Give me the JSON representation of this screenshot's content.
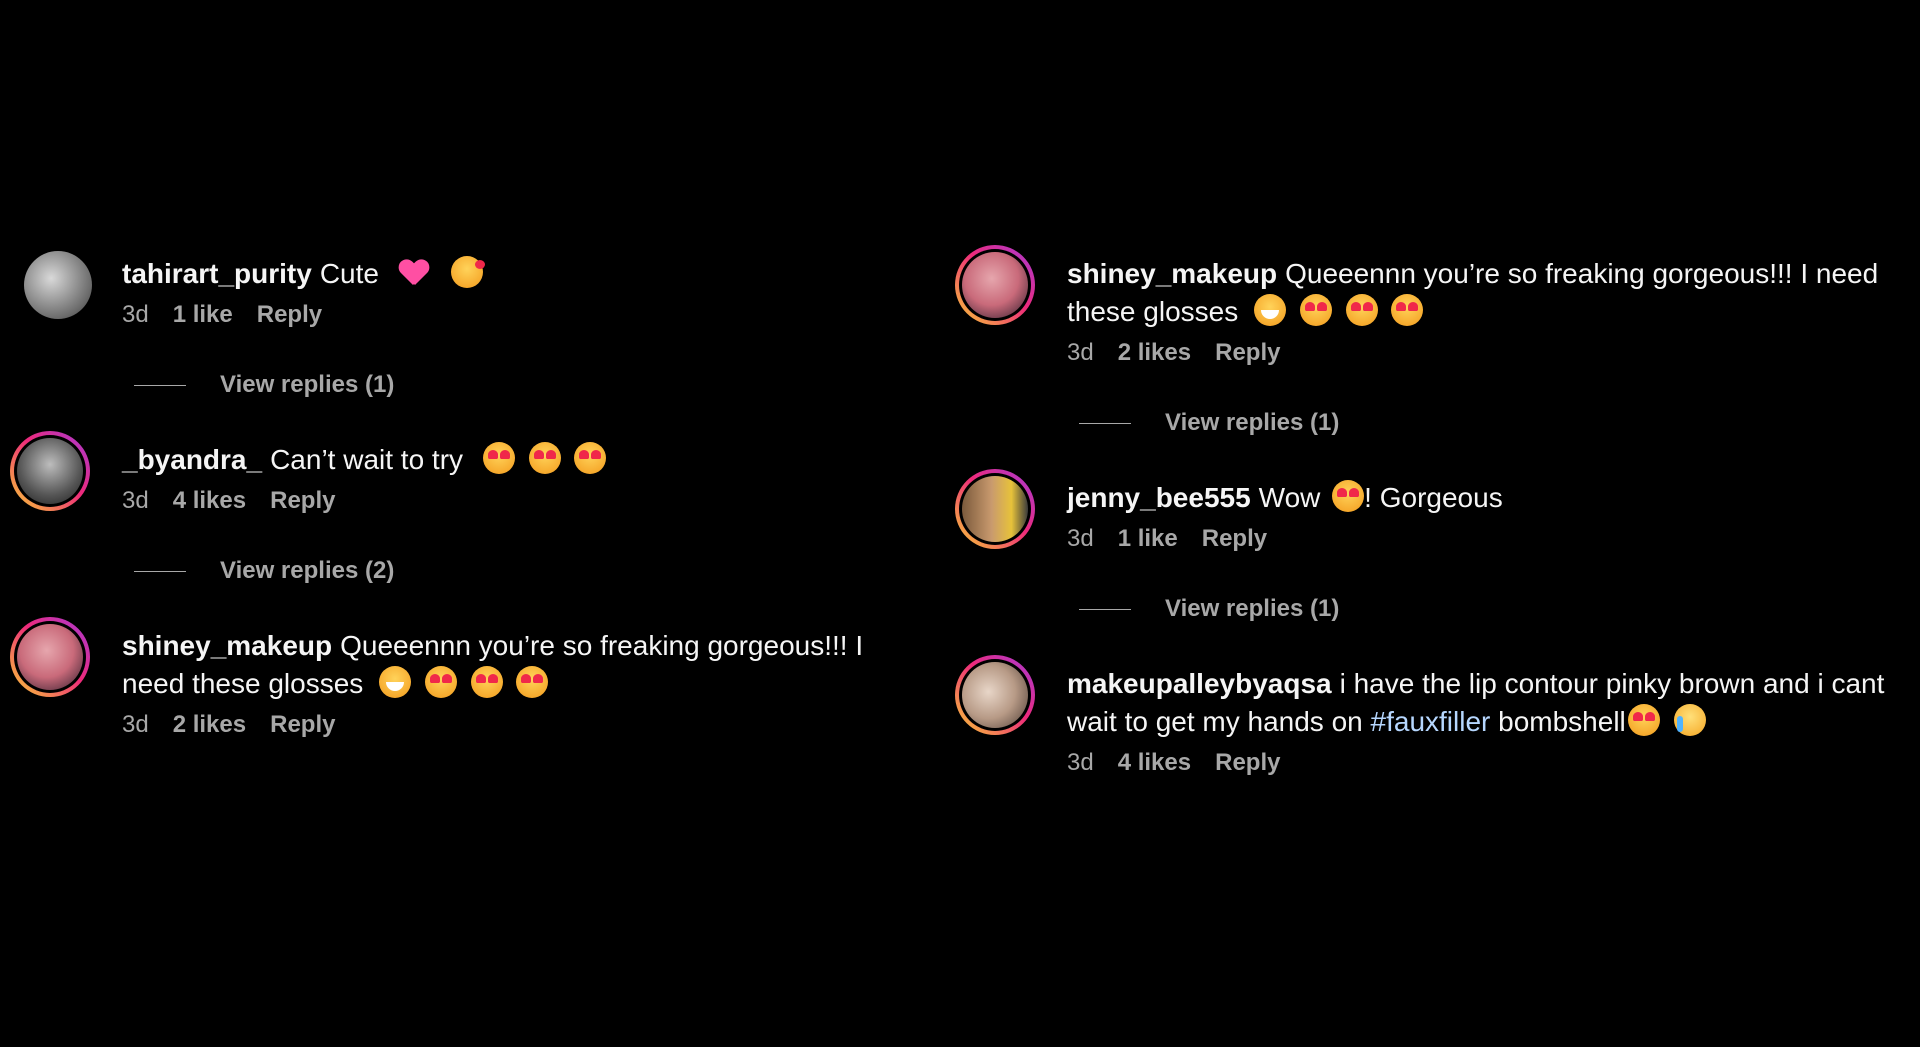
{
  "left_column": [
    {
      "username": "tahirart_purity",
      "text": "Cute",
      "emojis_after": [
        "pink-heart",
        "smiling-face-with-hearts"
      ],
      "time": "3d",
      "likes": "1 like",
      "reply": "Reply",
      "view_replies": "View replies (1)",
      "avatar_colors": [
        "#6b6b6b",
        "#d9d9d9"
      ],
      "ring": false
    },
    {
      "username": "_byandra_",
      "text": "Can’t wait to try",
      "emojis_after": [
        "heart-eyes",
        "heart-eyes",
        "heart-eyes"
      ],
      "time": "3d",
      "likes": "4 likes",
      "reply": "Reply",
      "view_replies": "View replies (2)",
      "avatar_colors": [
        "#3a3a3a",
        "#bdbdbd"
      ],
      "ring": true
    },
    {
      "username": "shiney_makeup",
      "text": "Queeennn you’re so freaking gorgeous!!! I need these glosses",
      "emojis_after": [
        "grin",
        "heart-eyes",
        "heart-eyes",
        "heart-eyes"
      ],
      "time": "3d",
      "likes": "2 likes",
      "reply": "Reply",
      "avatar_colors": [
        "#c96a7a",
        "#2b1a2a"
      ],
      "ring": true
    }
  ],
  "right_column": [
    {
      "username": "shiney_makeup",
      "text": "Queeennn you’re so freaking gorgeous!!! I need these glosses",
      "emojis_after": [
        "grin",
        "heart-eyes",
        "heart-eyes",
        "heart-eyes"
      ],
      "time": "3d",
      "likes": "2 likes",
      "reply": "Reply",
      "view_replies": "View replies (1)",
      "avatar_colors": [
        "#c96a7a",
        "#2b1a2a"
      ],
      "ring": true
    },
    {
      "username": "jenny_bee555",
      "text_before": "Wow",
      "text_after": "! Gorgeous",
      "time": "3d",
      "likes": "1 like",
      "reply": "Reply",
      "view_replies": "View replies (1)",
      "avatar_colors": [
        "#e7c23a",
        "#7b5a3c"
      ],
      "ring": true
    },
    {
      "username": "makeupalleybyaqsa",
      "text_before": "i have the lip contour pinky brown and i cant wait to get my hands on",
      "hashtag": "#fauxfiller",
      "text_after": "bombshell",
      "time": "3d",
      "likes": "4 likes",
      "reply": "Reply",
      "avatar_colors": [
        "#e8d6c8",
        "#4a3a32"
      ],
      "ring": true
    }
  ],
  "colors": {
    "background": "#000000",
    "text": "#f5f5f5",
    "meta": "#a8a8a8",
    "hashtag": "#b6d7ff",
    "story_ring": [
      "#f9ce34",
      "#ee2a7b",
      "#a43ad8"
    ]
  }
}
